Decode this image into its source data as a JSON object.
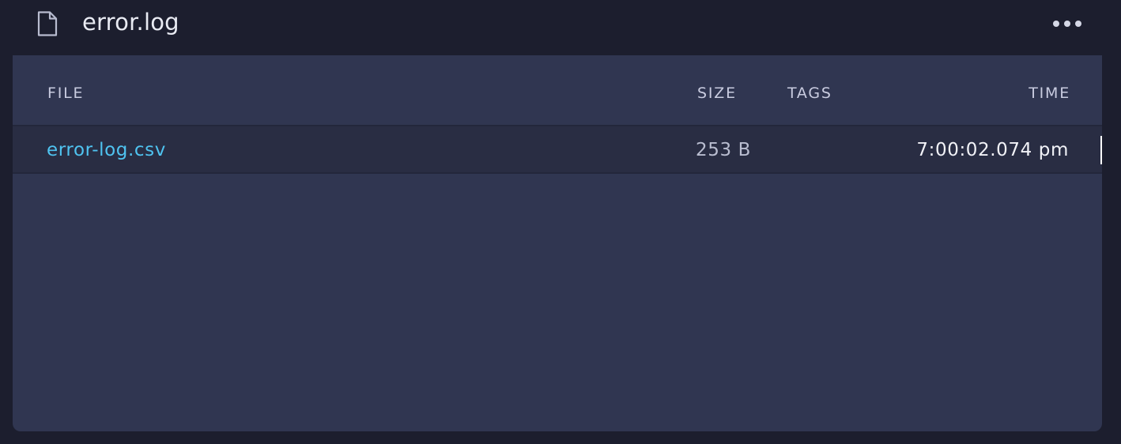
{
  "header": {
    "title": "error.log",
    "file_icon": "file-icon",
    "more_icon": "more-horizontal-icon"
  },
  "table": {
    "columns": [
      "FILE",
      "SIZE",
      "TAGS",
      "TIME"
    ],
    "rows": [
      {
        "file": "error-log.csv",
        "size": "253 B",
        "tags": "",
        "time": "7:00:02.074 pm"
      }
    ]
  },
  "colors": {
    "background": "#1c1e2e",
    "panel": "#303651",
    "row": "#292d43",
    "link": "#4fc3f0"
  }
}
